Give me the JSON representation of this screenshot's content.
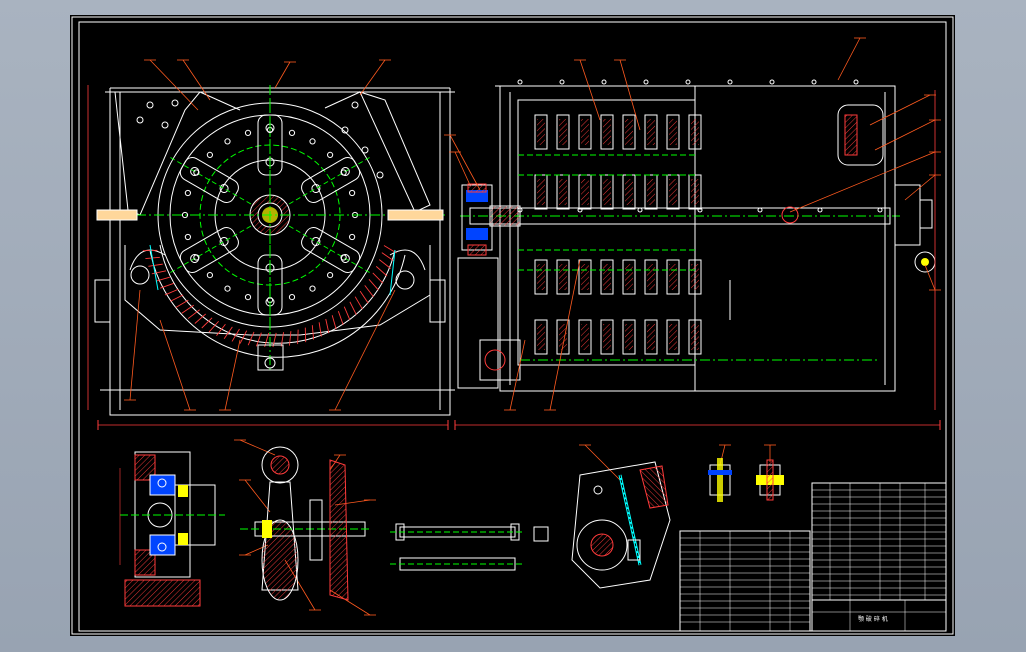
{
  "drawing": {
    "background": "#000000",
    "frame_color": "#ffffff",
    "workspace_color": "#a3adba",
    "title_block_text": "颚 破 碎 机",
    "colors": {
      "outline": "#ffffff",
      "centerline": "#00ff00",
      "hatch": "#ff3b3b",
      "dimension": "#ff3b3b",
      "leader": "#ff5a1f",
      "bolt": "#ffff00",
      "bearing": "#0044ff",
      "cyan": "#00ffff",
      "magenta": "#ff00ff"
    }
  }
}
